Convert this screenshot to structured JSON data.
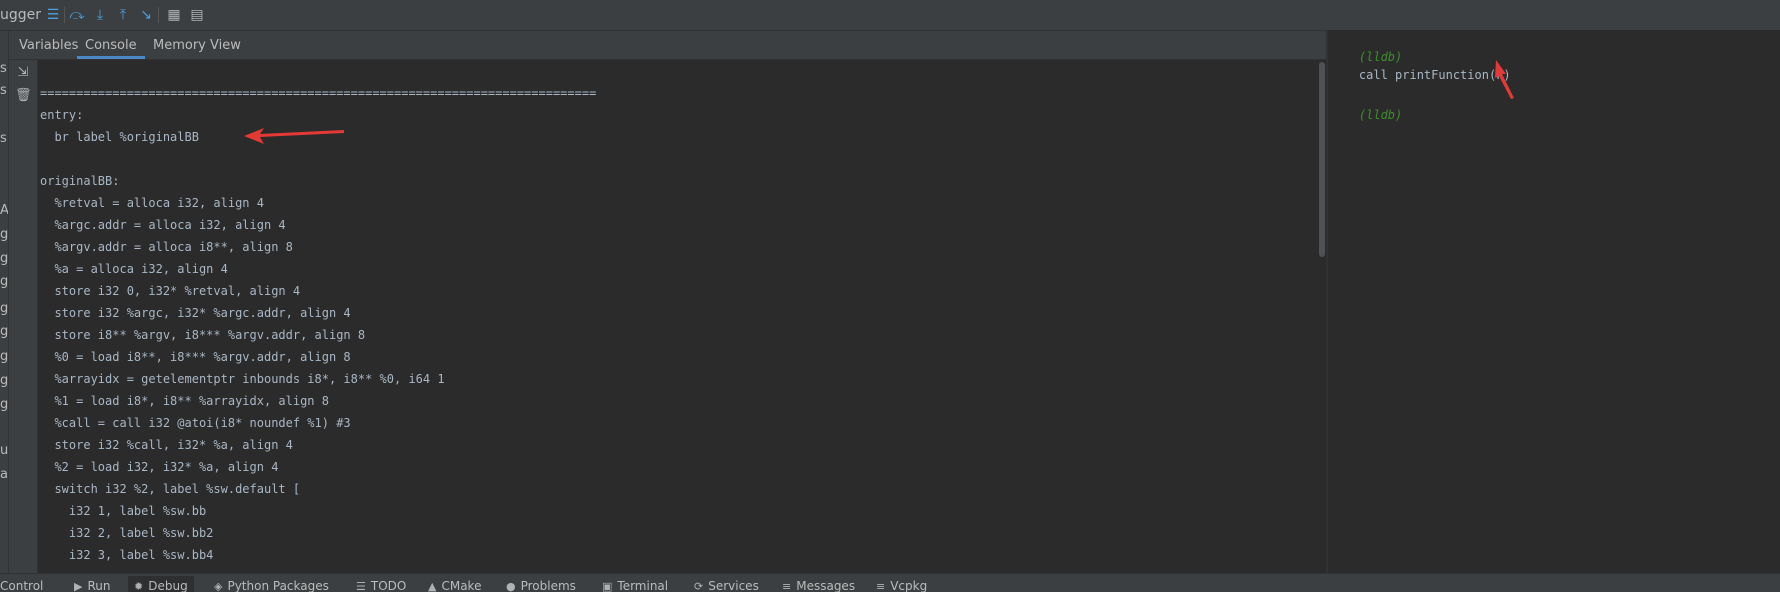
{
  "toolbar": {
    "title": "ugger",
    "icons": [
      "menu-icon",
      "step-over-icon",
      "step-into-icon",
      "step-out-icon",
      "run-to-cursor-icon",
      "evaluate-table-icon",
      "layout-icon"
    ]
  },
  "left_fragments": [
    "s",
    "s",
    "s",
    "A",
    "g",
    "g",
    "g",
    "g",
    "g",
    "g",
    "g",
    "g",
    "u",
    "a"
  ],
  "tabs": [
    {
      "label": "Variables"
    },
    {
      "label": "Console"
    },
    {
      "label": "Memory View"
    }
  ],
  "active_tab": "Console",
  "console_lines": [
    "=============================================================================",
    "entry:",
    "  br label %originalBB",
    "",
    "originalBB:",
    "  %retval = alloca i32, align 4",
    "  %argc.addr = alloca i32, align 4",
    "  %argv.addr = alloca i8**, align 8",
    "  %a = alloca i32, align 4",
    "  store i32 0, i32* %retval, align 4",
    "  store i32 %argc, i32* %argc.addr, align 4",
    "  store i8** %argv, i8*** %argv.addr, align 8",
    "  %0 = load i8**, i8*** %argv.addr, align 8",
    "  %arrayidx = getelementptr inbounds i8*, i8** %0, i64 1",
    "  %1 = load i8*, i8** %arrayidx, align 8",
    "  %call = call i32 @atoi(i8* noundef %1) #3",
    "  store i32 %call, i32* %a, align 4",
    "  %2 = load i32, i32* %a, align 4",
    "  switch i32 %2, label %sw.default [",
    "    i32 1, label %sw.bb",
    "    i32 2, label %sw.bb2",
    "    i32 3, label %sw.bb4"
  ],
  "lldb": {
    "prompt": "(lldb)",
    "command": "call printFunction(F)",
    "prompt2": "(lldb)"
  },
  "bottom_tabs": [
    {
      "label": "Control",
      "icon": ""
    },
    {
      "label": "Run",
      "icon": "▶"
    },
    {
      "label": "Debug",
      "icon": "✹"
    },
    {
      "label": "Python Packages",
      "icon": "◈"
    },
    {
      "label": "TODO",
      "icon": "☰"
    },
    {
      "label": "CMake",
      "icon": "▲"
    },
    {
      "label": "Problems",
      "icon": "●"
    },
    {
      "label": "Terminal",
      "icon": "▣"
    },
    {
      "label": "Services",
      "icon": "⟳"
    },
    {
      "label": "Messages",
      "icon": "≡"
    },
    {
      "label": "Vcpkg",
      "icon": "≡"
    }
  ],
  "colors": {
    "accent": "#4a88c7",
    "arrow": "#e53935",
    "lldb_prompt": "#3e8e2d"
  }
}
